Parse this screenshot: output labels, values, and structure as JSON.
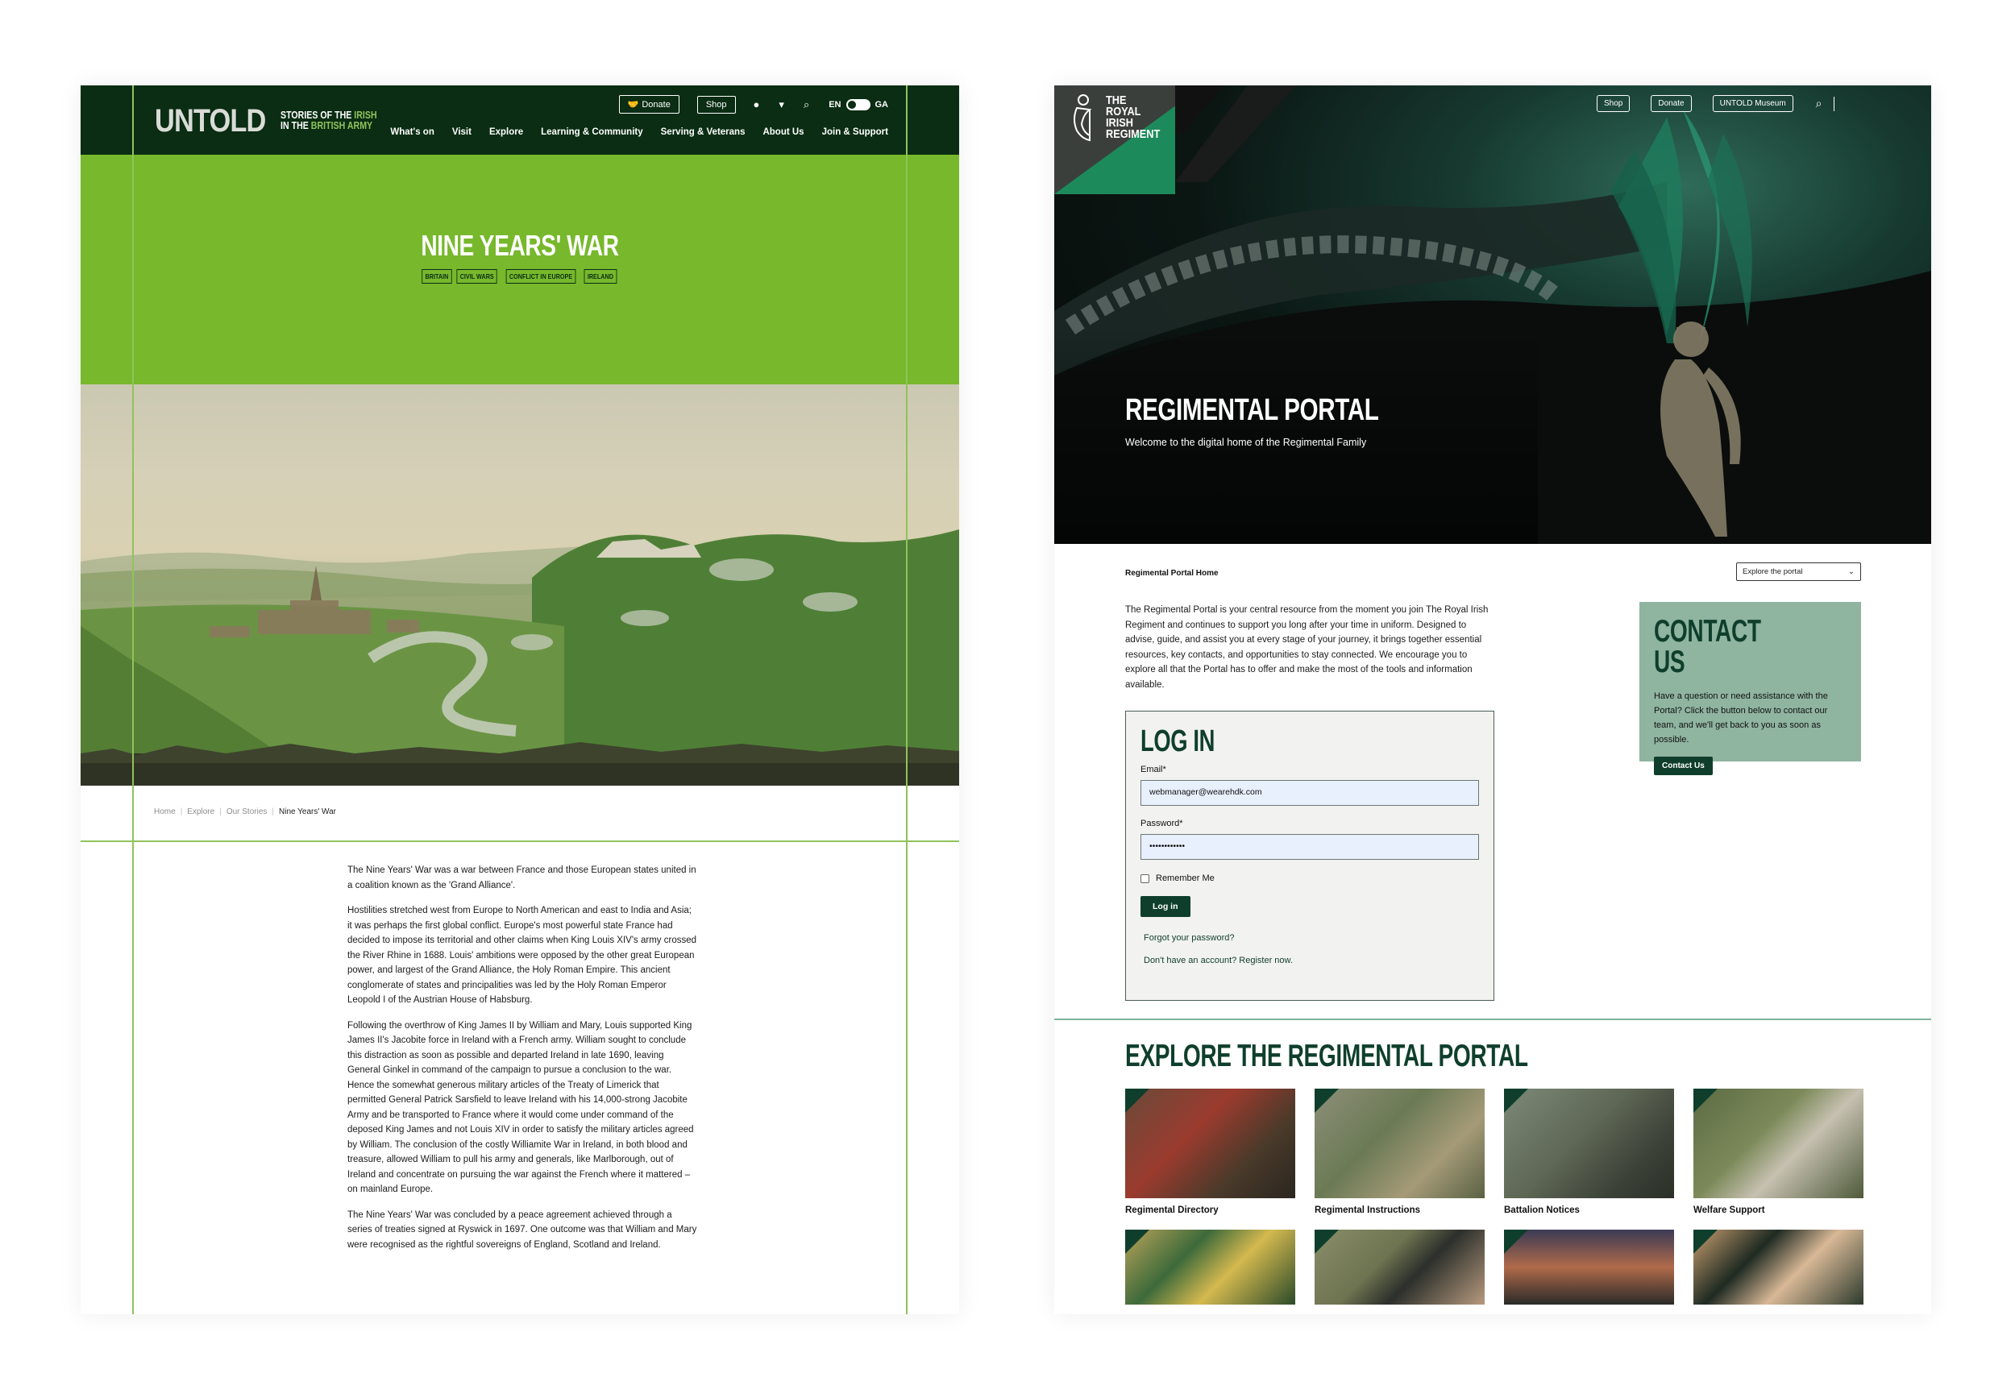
{
  "untold": {
    "logo": {
      "main": "UNTOLD",
      "line1_pre": "STORIES OF THE ",
      "line1_hl": "IRISH",
      "line2_pre": "IN THE ",
      "line2_hl": "BRITISH ARMY"
    },
    "top": {
      "donate": "Donate",
      "shop": "Shop",
      "lang_en": "EN",
      "lang_ga": "GA"
    },
    "nav": [
      "What's on",
      "Visit",
      "Explore",
      "Learning & Community",
      "Serving & Veterans",
      "About Us",
      "Join & Support"
    ],
    "title": "NINE YEARS' WAR",
    "tags": [
      "BRITAIN",
      "CIVIL WARS",
      "CONFLICT IN EUROPE",
      "IRELAND"
    ],
    "breadcrumb": [
      "Home",
      "Explore",
      "Our Stories",
      "Nine Years' War"
    ],
    "paragraphs": [
      "The Nine Years' War was a war between France and those European states united in a coalition known as the 'Grand Alliance'.",
      "Hostilities stretched west from Europe to North American and east to India and Asia; it was perhaps the first global conflict. Europe's most powerful state France had decided to impose its territorial and other claims when King Louis XIV's army crossed the River Rhine in 1688. Louis' ambitions were opposed by the other great European power, and largest of the Grand Alliance, the Holy Roman Empire. This ancient conglomerate of states and principalities was led by the Holy Roman Emperor Leopold I of the Austrian House of Habsburg.",
      "Following the overthrow of King James II by William and Mary, Louis supported King James II's Jacobite force in Ireland with a French army. William sought to conclude this distraction as soon as possible and departed Ireland in late 1690, leaving General Ginkel in command of the campaign to pursue a conclusion to the war. Hence the somewhat generous military articles of the Treaty of Limerick that permitted General Patrick Sarsfield to leave Ireland with his 14,000-strong Jacobite Army and be transported to France where it would come under command of the deposed King James and not Louis XIV in order to satisfy the military articles agreed by William. The conclusion of the costly Williamite War in Ireland, in both blood and treasure, allowed William to pull his army and generals, like Marlborough, out of Ireland and concentrate on pursuing the war against the French where it mattered – on mainland Europe.",
      "The Nine Years' War was concluded by a peace agreement achieved through a series of treaties signed at Ryswick in 1697. One outcome was that William and Mary were recognised as the rightful sovereigns of England, Scotland and Ireland."
    ],
    "colors": {
      "header": "#0a2d13",
      "hero": "#77b82c",
      "line": "#8fc35a"
    }
  },
  "rir": {
    "crest": {
      "line1": "THE",
      "line2": "ROYAL",
      "line3": "IRISH",
      "line4": "REGIMENT"
    },
    "top": [
      "Shop",
      "Donate",
      "UNTOLD Museum"
    ],
    "title": "REGIMENTAL PORTAL",
    "subtitle": "Welcome to the digital home of the Regimental Family",
    "breadcrumb": "Regimental Portal Home",
    "select": "Explore the portal",
    "intro": "The Regimental Portal is your central resource from the moment you join The Royal Irish Regiment and continues to support you long after your time in uniform. Designed to advise, guide, and assist you at every stage of your journey, it brings together essential resources, key contacts, and opportunities to stay connected. We encourage you to explore all that the Portal has to offer and make the most of the tools and information available.",
    "contact": {
      "title": "CONTACT US",
      "text": "Have a question or need assistance with the Portal? Click the button below to contact our team, and we'll get back to you as soon as possible.",
      "button": "Contact Us"
    },
    "login": {
      "title": "LOG IN",
      "email_label": "Email*",
      "email_value": "webmanager@wearehdk.com",
      "password_label": "Password*",
      "password_value": "••••••••••••",
      "remember": "Remember Me",
      "button": "Log in",
      "forgot": "Forgot your password?",
      "register": "Don't have an account? Register now."
    },
    "explore_title": "EXPLORE THE REGIMENTAL PORTAL",
    "tiles": [
      "Regimental Directory",
      "Regimental Instructions",
      "Battalion Notices",
      "Welfare Support"
    ],
    "colors": {
      "primary": "#0f3f2c",
      "contact_bg": "#8fb4a0",
      "input_bg": "#e8effd"
    }
  }
}
